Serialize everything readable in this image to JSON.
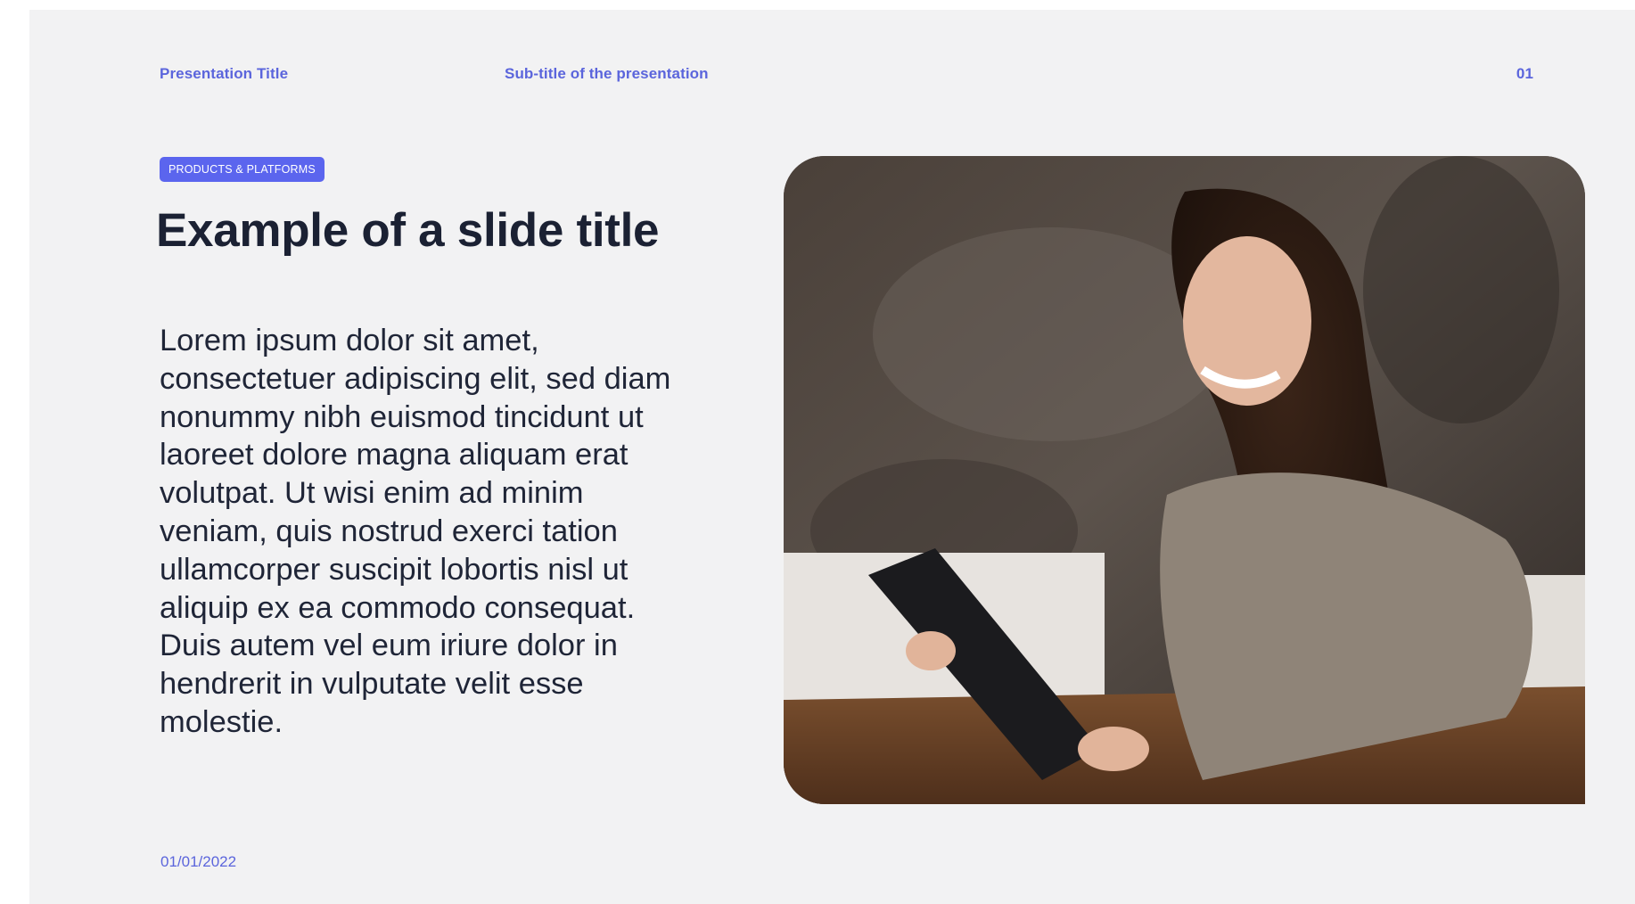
{
  "header": {
    "presentation_title": "Presentation Title",
    "subtitle": "Sub-title of the presentation",
    "slide_number": "01"
  },
  "slide": {
    "tag": "PRODUCTS & PLATFORMS",
    "title": "Example of a slide title",
    "body": "Lorem ipsum dolor sit amet, consectetuer adipiscing elit, sed diam nonummy nibh euismod tincidunt ut laoreet dolore magna aliquam erat volutpat. Ut wisi enim ad minim veniam, quis nostrud exerci tation ullamcorper suscipit lobortis nisl ut aliquip ex ea commodo consequat. Duis autem vel eum iriure dolor in hendrerit in vulputate velit esse molestie.",
    "photo_description": "woman-smiling-holding-tablet-at-table",
    "date": "01/01/2022"
  },
  "colors": {
    "accent": "#5b65dc",
    "tag_bg": "#5b65ee",
    "text_dark": "#1b2133",
    "slide_bg": "#f2f2f3"
  }
}
